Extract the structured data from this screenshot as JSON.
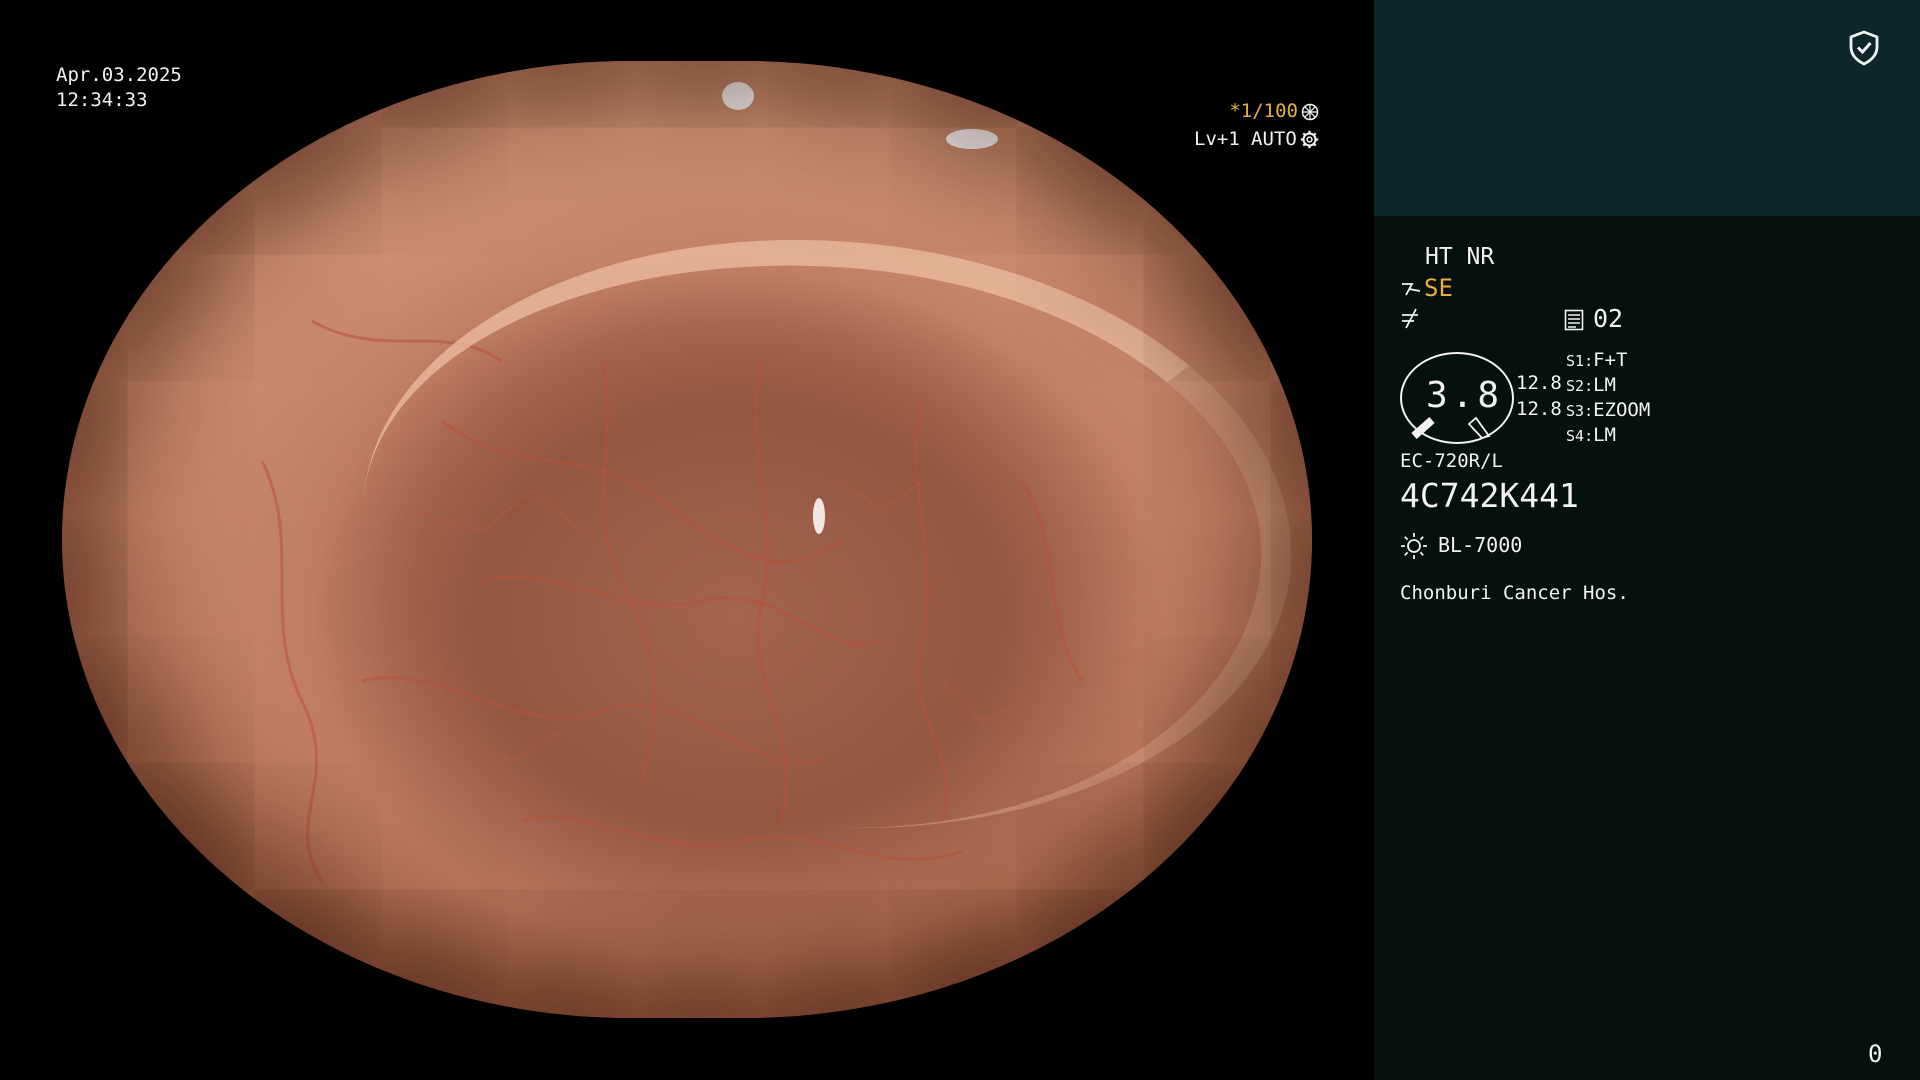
{
  "overlay": {
    "date": "Apr.03.2025",
    "time": "12:34:33",
    "shutter": "*1/100",
    "level": "Lv+1",
    "mode": "AUTO"
  },
  "panel": {
    "ht_nr": "HT NR",
    "se": "SE",
    "memory_index": "02",
    "score_value": "3.8",
    "score_left_1": "12.8",
    "score_left_2": "12.8",
    "switches": [
      {
        "key": "S1",
        "value": "F+T"
      },
      {
        "key": "S2",
        "value": "LM"
      },
      {
        "key": "S3",
        "value": "EZOOM"
      },
      {
        "key": "S4",
        "value": "LM"
      }
    ],
    "scope_model": "EC-720R/L",
    "serial": "4C742K441",
    "light_source": "BL-7000",
    "institution": "Chonburi Cancer Hos.",
    "counter": "0"
  },
  "icons": {
    "shield": "shield-check-icon",
    "aperture": "aperture-icon",
    "gear": "gear-icon",
    "light": "sun-icon",
    "memory": "list-icon"
  },
  "colors": {
    "accent_yellow": "#e8b03a",
    "panel_top": "#0d2627",
    "panel_bottom": "#06100f"
  }
}
